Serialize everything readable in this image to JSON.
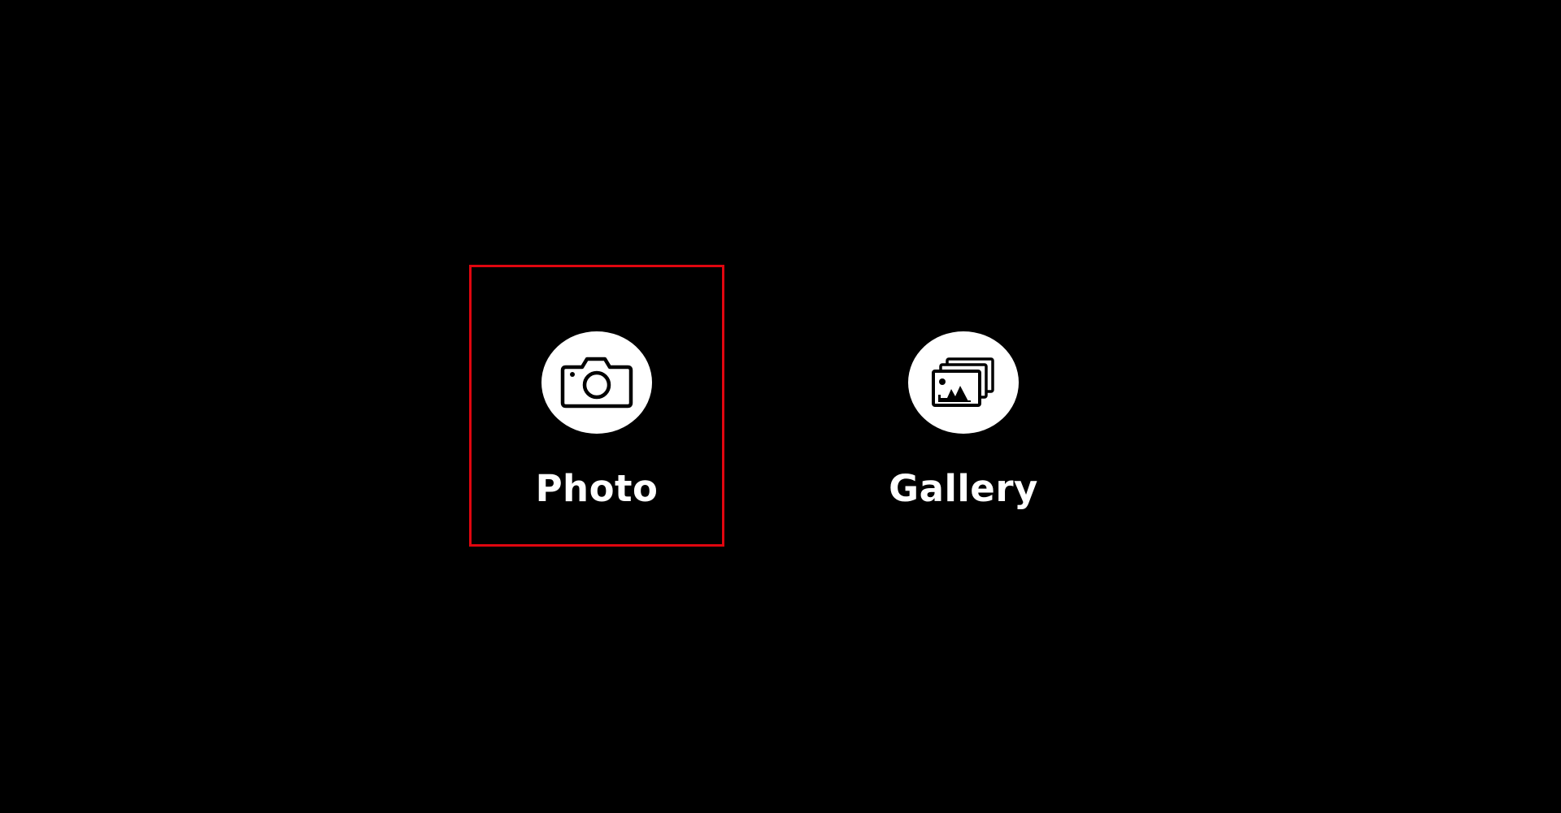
{
  "background_color": "#000000",
  "highlight_color": "#e0060f",
  "options": [
    {
      "id": "photo",
      "label": "Photo",
      "icon": "camera-icon",
      "selected": true
    },
    {
      "id": "gallery",
      "label": "Gallery",
      "icon": "gallery-icon",
      "selected": false
    }
  ]
}
